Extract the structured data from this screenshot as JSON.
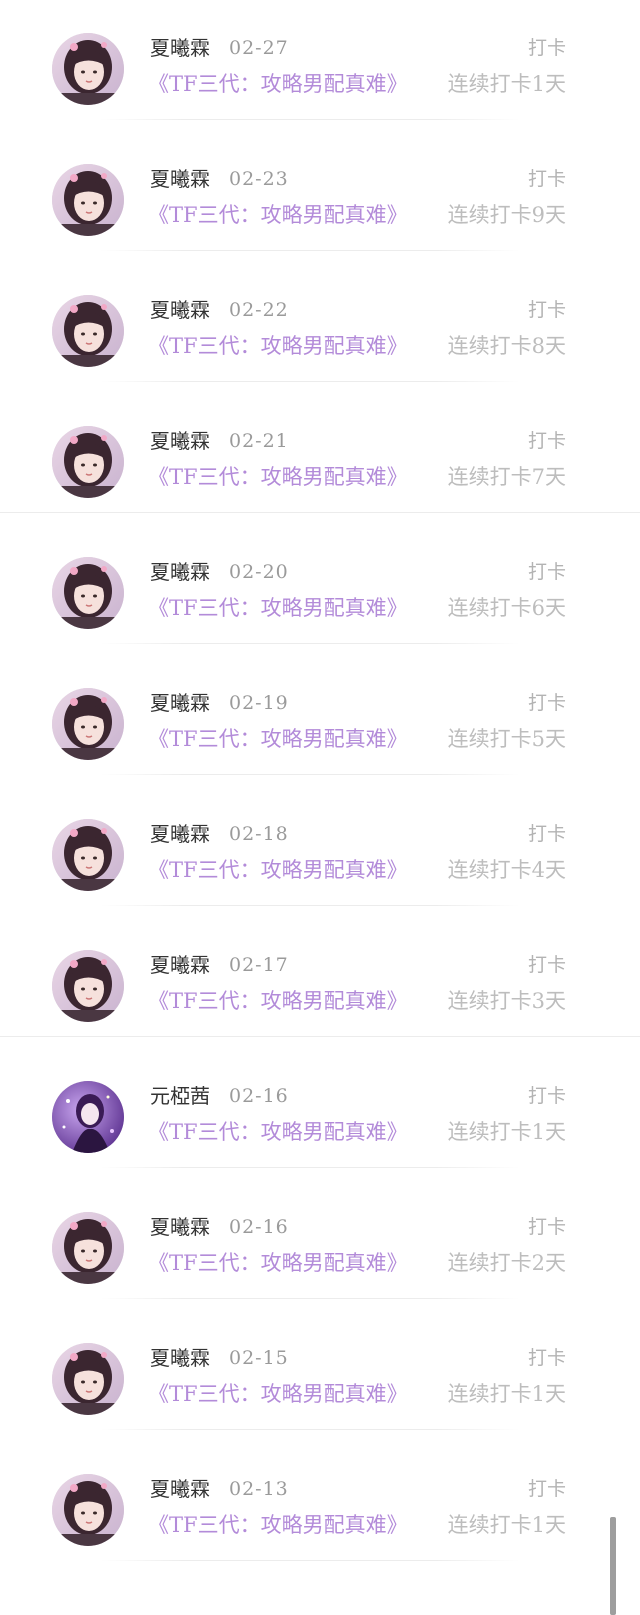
{
  "feed": {
    "items": [
      {
        "name": "夏曦霖",
        "date": "02-27",
        "tag": "打卡",
        "title": "《TF三代：攻略男配真难》",
        "streak": "连续打卡1天",
        "avatar": "girl-portrait-avatar"
      },
      {
        "name": "夏曦霖",
        "date": "02-23",
        "tag": "打卡",
        "title": "《TF三代：攻略男配真难》",
        "streak": "连续打卡9天",
        "avatar": "girl-portrait-avatar"
      },
      {
        "name": "夏曦霖",
        "date": "02-22",
        "tag": "打卡",
        "title": "《TF三代：攻略男配真难》",
        "streak": "连续打卡8天",
        "avatar": "girl-portrait-avatar"
      },
      {
        "name": "夏曦霖",
        "date": "02-21",
        "tag": "打卡",
        "title": "《TF三代：攻略男配真难》",
        "streak": "连续打卡7天",
        "avatar": "girl-portrait-avatar"
      },
      {
        "name": "夏曦霖",
        "date": "02-20",
        "tag": "打卡",
        "title": "《TF三代：攻略男配真难》",
        "streak": "连续打卡6天",
        "avatar": "girl-portrait-avatar"
      },
      {
        "name": "夏曦霖",
        "date": "02-19",
        "tag": "打卡",
        "title": "《TF三代：攻略男配真难》",
        "streak": "连续打卡5天",
        "avatar": "girl-portrait-avatar"
      },
      {
        "name": "夏曦霖",
        "date": "02-18",
        "tag": "打卡",
        "title": "《TF三代：攻略男配真难》",
        "streak": "连续打卡4天",
        "avatar": "girl-portrait-avatar"
      },
      {
        "name": "夏曦霖",
        "date": "02-17",
        "tag": "打卡",
        "title": "《TF三代：攻略男配真难》",
        "streak": "连续打卡3天",
        "avatar": "girl-portrait-avatar"
      },
      {
        "name": "元椏茜",
        "date": "02-16",
        "tag": "打卡",
        "title": "《TF三代：攻略男配真难》",
        "streak": "连续打卡1天",
        "avatar": "purple-character-avatar"
      },
      {
        "name": "夏曦霖",
        "date": "02-16",
        "tag": "打卡",
        "title": "《TF三代：攻略男配真难》",
        "streak": "连续打卡2天",
        "avatar": "girl-portrait-avatar"
      },
      {
        "name": "夏曦霖",
        "date": "02-15",
        "tag": "打卡",
        "title": "《TF三代：攻略男配真难》",
        "streak": "连续打卡1天",
        "avatar": "girl-portrait-avatar"
      },
      {
        "name": "夏曦霖",
        "date": "02-13",
        "tag": "打卡",
        "title": "《TF三代：攻略男配真难》",
        "streak": "连续打卡1天",
        "avatar": "girl-portrait-avatar"
      }
    ]
  },
  "colors": {
    "name": "#333333",
    "date": "#9a9a9a",
    "title": "#b38bd9",
    "streak": "#bdbdbd",
    "tag": "#b3b3b3"
  }
}
